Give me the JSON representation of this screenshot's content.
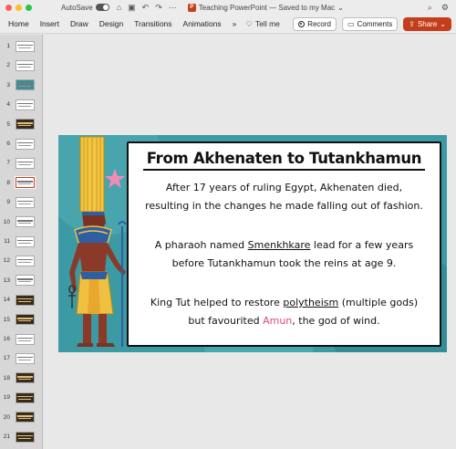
{
  "titlebar": {
    "autosave_label": "AutoSave",
    "doc_title": "Teaching PowerPoint — Saved to my Mac",
    "dropdown_glyph": "⌄",
    "app_badge": "P"
  },
  "ribbon": {
    "tabs": [
      "Home",
      "Insert",
      "Draw",
      "Design",
      "Transitions",
      "Animations"
    ],
    "tellme_label": "Tell me",
    "record_label": "Record",
    "comments_label": "Comments",
    "share_label": "Share",
    "share_color": "#c43e1c"
  },
  "thumbnails": {
    "numbers": [
      "1",
      "2",
      "3",
      "4",
      "5",
      "6",
      "7",
      "8",
      "9",
      "10",
      "11",
      "12",
      "13",
      "14",
      "15",
      "16",
      "17",
      "18",
      "19",
      "20",
      "21"
    ],
    "selected": "8"
  },
  "slide": {
    "title": "From Akhenaten to Tutankhamun",
    "p1_line1": "After 17 years of ruling Egypt, Akhenaten died,",
    "p1_line2": "resulting in the changes he made falling out of fashion.",
    "p2_line1_a": "A pharaoh named ",
    "p2_line1_u": "Smenkhkare",
    "p2_line1_b": " lead for a few years",
    "p2_line2": "before Tutankhamun took the reins at age 9.",
    "p3_line1_a": "King Tut helped to restore ",
    "p3_line1_u": "polytheism",
    "p3_line1_b": " (multiple gods)",
    "p3_line2_a": "but favourited ",
    "p3_line2_pink": "Amun",
    "p3_line2_b": ", the god of wind.",
    "accent_pink": "#e2457e",
    "background_color": "#3b9aa3"
  }
}
